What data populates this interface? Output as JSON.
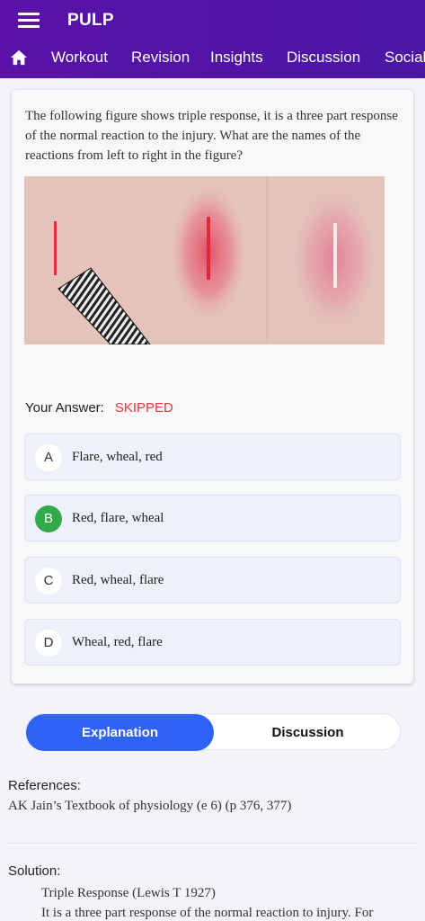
{
  "app": {
    "title": "PULP"
  },
  "nav": {
    "items": [
      "Workout",
      "Revision",
      "Insights",
      "Discussion",
      "Social"
    ]
  },
  "question": {
    "text": "The following figure shows triple response, it is a three part response of the normal reaction to the injury. What are the names of the reactions from left to right in the figure?"
  },
  "answer": {
    "label": "Your Answer:",
    "status": "SKIPPED"
  },
  "options": [
    {
      "letter": "A",
      "text": "Flare, wheal, red",
      "correct": false
    },
    {
      "letter": "B",
      "text": "Red, flare, wheal",
      "correct": true
    },
    {
      "letter": "C",
      "text": "Red, wheal, flare",
      "correct": false
    },
    {
      "letter": "D",
      "text": "Wheal, red, flare",
      "correct": false
    }
  ],
  "tabs": {
    "explanation": "Explanation",
    "discussion": "Discussion"
  },
  "references": {
    "label": "References:",
    "text": "AK Jain’s Textbook of physiology (e 6) (p 376, 377)"
  },
  "solution": {
    "label": "Solution:",
    "line1": "Triple Response (Lewis T 1927)",
    "line2": "It is a three part response of the normal reaction to injury. For"
  },
  "colors": {
    "appbar": "#5a12a8",
    "accent": "#2f63f5",
    "correct": "#32a94a",
    "skipped": "#e03a3a"
  },
  "icons": {
    "menu": "menu-icon",
    "home": "home-icon"
  }
}
